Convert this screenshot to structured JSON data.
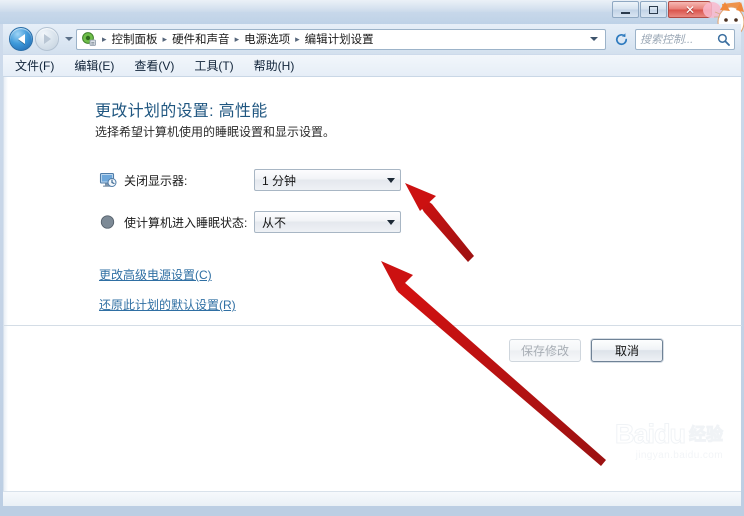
{
  "window": {
    "controls": {
      "minimize_label": "–",
      "maximize_label": "",
      "close_label": "✕"
    }
  },
  "navbar": {
    "back_title": "后退",
    "forward_title": "前进",
    "breadcrumb": [
      "控制面板",
      "硬件和声音",
      "电源选项",
      "编辑计划设置"
    ],
    "separator": "▸",
    "search_placeholder": "搜索控制...",
    "refresh_label": "↻"
  },
  "menubar": {
    "items": [
      {
        "label": "文件(F)"
      },
      {
        "label": "编辑(E)"
      },
      {
        "label": "查看(V)"
      },
      {
        "label": "工具(T)"
      },
      {
        "label": "帮助(H)"
      }
    ]
  },
  "main": {
    "title": "更改计划的设置: 高性能",
    "subtitle": "选择希望计算机使用的睡眠设置和显示设置。",
    "settings": [
      {
        "icon": "monitor-icon",
        "label": "关闭显示器:",
        "value": "1 分钟"
      },
      {
        "icon": "sleep-moon-icon",
        "label": "使计算机进入睡眠状态:",
        "value": "从不"
      }
    ],
    "links": [
      {
        "label": "更改高级电源设置(C)"
      },
      {
        "label": "还原此计划的默认设置(R)"
      }
    ],
    "buttons": {
      "save_label": "保存修改",
      "cancel_label": "取消"
    }
  },
  "watermark": {
    "brand": "Baidu",
    "product": "经验",
    "url": "jingyan.baidu.com"
  },
  "colors": {
    "accent_link": "#2f6fa3",
    "title_text": "#1f5680",
    "annotation_red": "#cc1111",
    "chrome_blue": "#c4d3e6"
  }
}
